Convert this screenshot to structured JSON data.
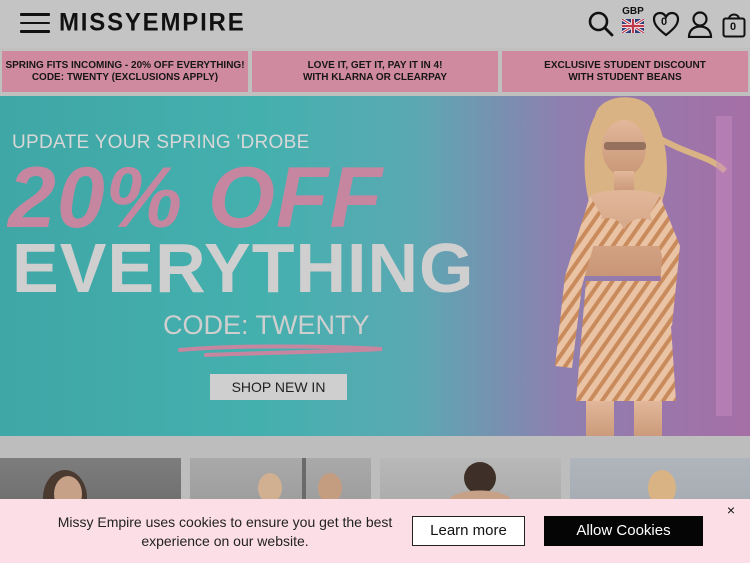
{
  "header": {
    "logo": "MISSYEMPIRE",
    "currency": "GBP",
    "wishlist_count": "0",
    "bag_count": "0"
  },
  "promos": [
    {
      "line1": "SPRING FITS INCOMING - 20% OFF EVERYTHING!",
      "line2": "CODE: TWENTY (EXCLUSIONS APPLY)"
    },
    {
      "line1": "LOVE IT, GET IT, PAY IT IN 4!",
      "line2": "WITH KLARNA OR CLEARPAY"
    },
    {
      "line1": "EXCLUSIVE STUDENT DISCOUNT",
      "line2": "WITH STUDENT BEANS"
    }
  ],
  "hero": {
    "eyebrow": "UPDATE YOUR SPRING 'DROBE",
    "headline1": "20% OFF",
    "headline2": "EVERYTHING",
    "code": "CODE: TWENTY",
    "cta": "SHOP NEW IN"
  },
  "cookie": {
    "message": "Missy Empire uses cookies to ensure you get the best experience on our website.",
    "learn_more": "Learn more",
    "allow": "Allow Cookies",
    "close": "×"
  },
  "colors": {
    "promo_bg": "#d08aa0",
    "hero_pink": "#c786a0",
    "cookie_bg": "#fcdfe6",
    "allow_bg": "#050505"
  }
}
